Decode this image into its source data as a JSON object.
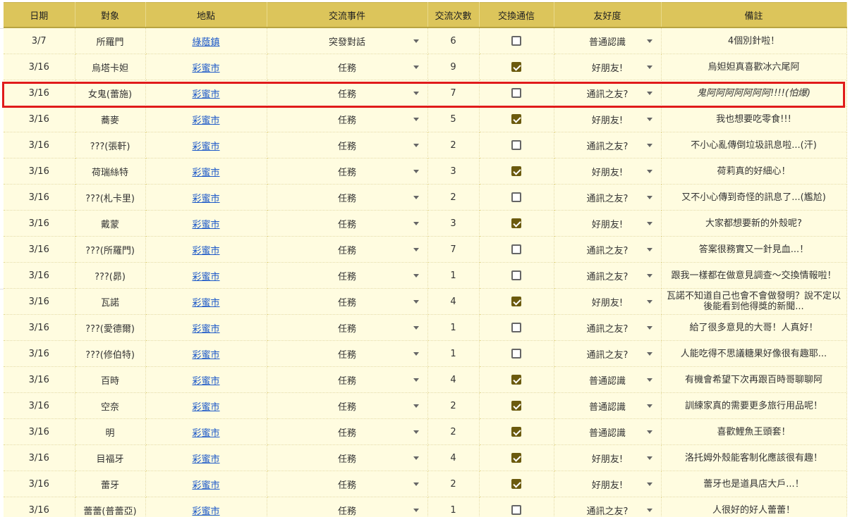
{
  "headers": [
    "日期",
    "對象",
    "地點",
    "交流事件",
    "交流次數",
    "交換通信",
    "友好度",
    "備註"
  ],
  "rows": [
    {
      "date": "3/7",
      "target": "所羅門",
      "place": "綠蔭鎮",
      "event": "突發對話",
      "count": "6",
      "exchange": false,
      "friend": "普通認識",
      "note": "4個別針啦！"
    },
    {
      "date": "3/16",
      "target": "烏塔卡妲",
      "place": "彩蜜市",
      "event": "任務",
      "count": "9",
      "exchange": true,
      "friend": "好朋友!",
      "note": "烏妲妲真喜歡冰六尾阿"
    },
    {
      "date": "3/16",
      "target": "女鬼(蕾施)",
      "place": "彩蜜市",
      "event": "任務",
      "count": "7",
      "exchange": false,
      "friend": "通訊之友?",
      "note": "鬼阿阿阿阿阿阿阿!!!!(怕爆)",
      "italic": true
    },
    {
      "date": "3/16",
      "target": "蕎麥",
      "place": "彩蜜市",
      "event": "任務",
      "count": "5",
      "exchange": true,
      "friend": "好朋友!",
      "note": "我也想要吃零食!!!"
    },
    {
      "date": "3/16",
      "target": "???(張軒)",
      "place": "彩蜜市",
      "event": "任務",
      "count": "2",
      "exchange": false,
      "friend": "通訊之友?",
      "note": "不小心亂傳倒垃圾訊息啦...(汗)"
    },
    {
      "date": "3/16",
      "target": "荷瑞絲特",
      "place": "彩蜜市",
      "event": "任務",
      "count": "3",
      "exchange": true,
      "friend": "好朋友!",
      "note": "荷莉真的好細心！"
    },
    {
      "date": "3/16",
      "target": "???(札卡里)",
      "place": "彩蜜市",
      "event": "任務",
      "count": "2",
      "exchange": false,
      "friend": "通訊之友?",
      "note": "又不小心傳到奇怪的訊息了...(尷尬)"
    },
    {
      "date": "3/16",
      "target": "戴蒙",
      "place": "彩蜜市",
      "event": "任務",
      "count": "3",
      "exchange": true,
      "friend": "好朋友!",
      "note": "大家都想要新的外殼呢?"
    },
    {
      "date": "3/16",
      "target": "???(所羅門)",
      "place": "彩蜜市",
      "event": "任務",
      "count": "7",
      "exchange": false,
      "friend": "通訊之友?",
      "note": "答案很務實又一針見血...！"
    },
    {
      "date": "3/16",
      "target": "???(昴)",
      "place": "彩蜜市",
      "event": "任務",
      "count": "1",
      "exchange": false,
      "friend": "通訊之友?",
      "note": "跟我一樣都在做意見調查～交換情報啦！"
    },
    {
      "date": "3/16",
      "target": "瓦諾",
      "place": "彩蜜市",
      "event": "任務",
      "count": "4",
      "exchange": true,
      "friend": "好朋友!",
      "note": "瓦諾不知道自己也會不會做發明？說不定以後能看到他得獎的新聞..."
    },
    {
      "date": "3/16",
      "target": "???(愛德爾)",
      "place": "彩蜜市",
      "event": "任務",
      "count": "1",
      "exchange": false,
      "friend": "通訊之友?",
      "note": "給了很多意見的大哥！人真好！"
    },
    {
      "date": "3/16",
      "target": "???(修伯特)",
      "place": "彩蜜市",
      "event": "任務",
      "count": "1",
      "exchange": false,
      "friend": "通訊之友?",
      "note": "人能吃得不思議糖果好像很有趣耶..."
    },
    {
      "date": "3/16",
      "target": "百時",
      "place": "彩蜜市",
      "event": "任務",
      "count": "4",
      "exchange": true,
      "friend": "普通認識",
      "note": "有機會希望下次再跟百時哥聊聊阿"
    },
    {
      "date": "3/16",
      "target": "空奈",
      "place": "彩蜜市",
      "event": "任務",
      "count": "2",
      "exchange": true,
      "friend": "普通認識",
      "note": "訓練家真的需要更多旅行用品呢！"
    },
    {
      "date": "3/16",
      "target": "明",
      "place": "彩蜜市",
      "event": "任務",
      "count": "2",
      "exchange": true,
      "friend": "普通認識",
      "note": "喜歡鯉魚王頭套！"
    },
    {
      "date": "3/16",
      "target": "目福牙",
      "place": "彩蜜市",
      "event": "任務",
      "count": "4",
      "exchange": true,
      "friend": "好朋友!",
      "note": "洛托姆外殼能客制化應該很有趣！"
    },
    {
      "date": "3/16",
      "target": "蕾牙",
      "place": "彩蜜市",
      "event": "任務",
      "count": "2",
      "exchange": true,
      "friend": "好朋友!",
      "note": "蕾牙也是道具店大戶...！"
    },
    {
      "date": "3/16",
      "target": "蕾蕾(普蕾亞)",
      "place": "彩蜜市",
      "event": "任務",
      "count": "1",
      "exchange": false,
      "friend": "通訊之友?",
      "note": "人很好的好人蕾蕾！"
    }
  ]
}
